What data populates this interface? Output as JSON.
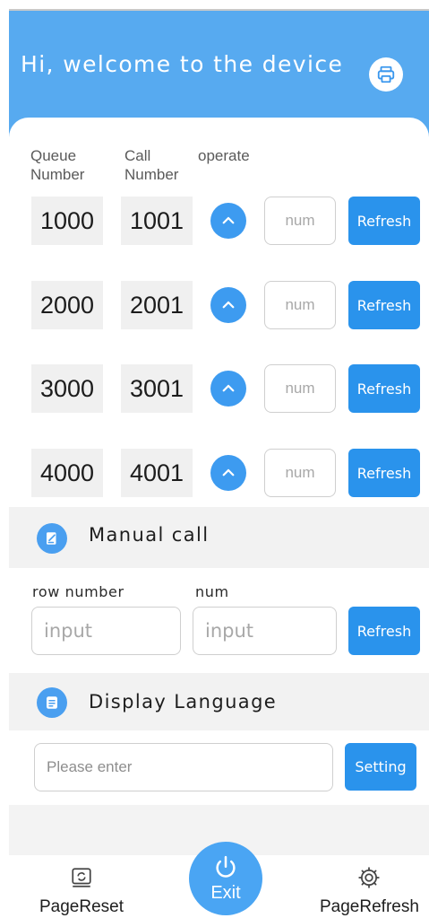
{
  "header": {
    "title": "Hi, welcome to the device",
    "print_icon": "printer-icon"
  },
  "columns": {
    "queue_line1": "Queue",
    "queue_line2": "Number",
    "call_line1": "Call",
    "call_line2": "Number",
    "operate": "operate"
  },
  "rows": [
    {
      "queue": "1000",
      "call": "1001",
      "placeholder": "num",
      "button": "Refresh"
    },
    {
      "queue": "2000",
      "call": "2001",
      "placeholder": "num",
      "button": "Refresh"
    },
    {
      "queue": "3000",
      "call": "3001",
      "placeholder": "num",
      "button": "Refresh"
    },
    {
      "queue": "4000",
      "call": "4001",
      "placeholder": "num",
      "button": "Refresh"
    }
  ],
  "manual_call": {
    "title": "Manual call",
    "row_label": "row number",
    "num_label": "num",
    "row_placeholder": "input",
    "num_placeholder": "input",
    "button": "Refresh"
  },
  "display_language": {
    "title": "Display Language",
    "placeholder": "Please enter",
    "button": "Setting"
  },
  "nav": {
    "page_reset": "PageReset",
    "exit": "Exit",
    "page_refresh": "PageRefresh"
  },
  "colors": {
    "header": "#57aaf0",
    "accent": "#2a93ec",
    "section_bg": "#f2f2f2"
  }
}
